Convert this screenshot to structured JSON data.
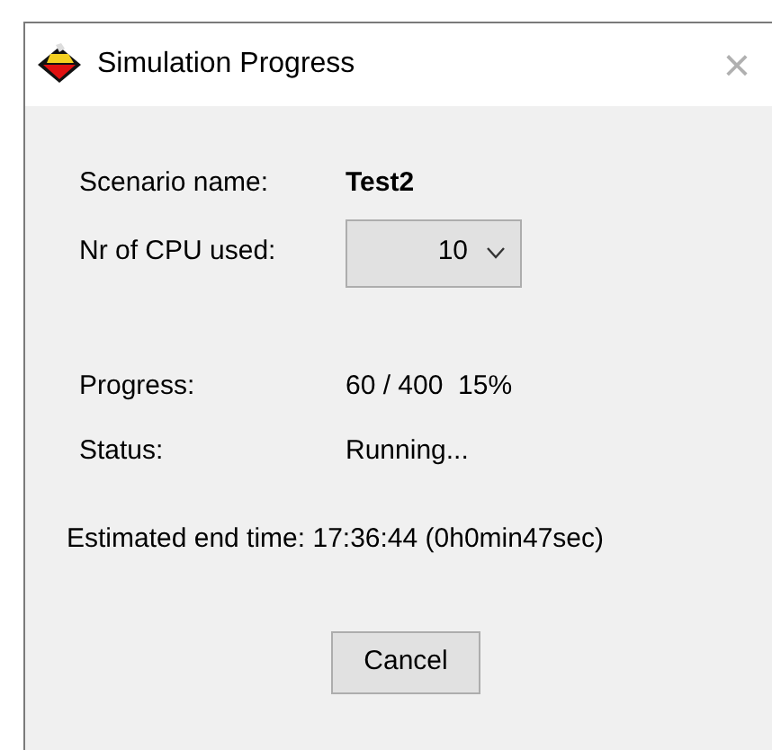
{
  "window": {
    "title": "Simulation Progress",
    "close": "×"
  },
  "scenario": {
    "label": "Scenario name:",
    "value": "Test2"
  },
  "cpu": {
    "label": "Nr of CPU used:",
    "value": "10"
  },
  "progress": {
    "label": "Progress:",
    "value": "60 / 400  15%"
  },
  "status": {
    "label": "Status:",
    "value": "Running..."
  },
  "estimate": "Estimated end time: 17:36:44 (0h0min47sec)",
  "buttons": [
    "Cancel"
  ]
}
